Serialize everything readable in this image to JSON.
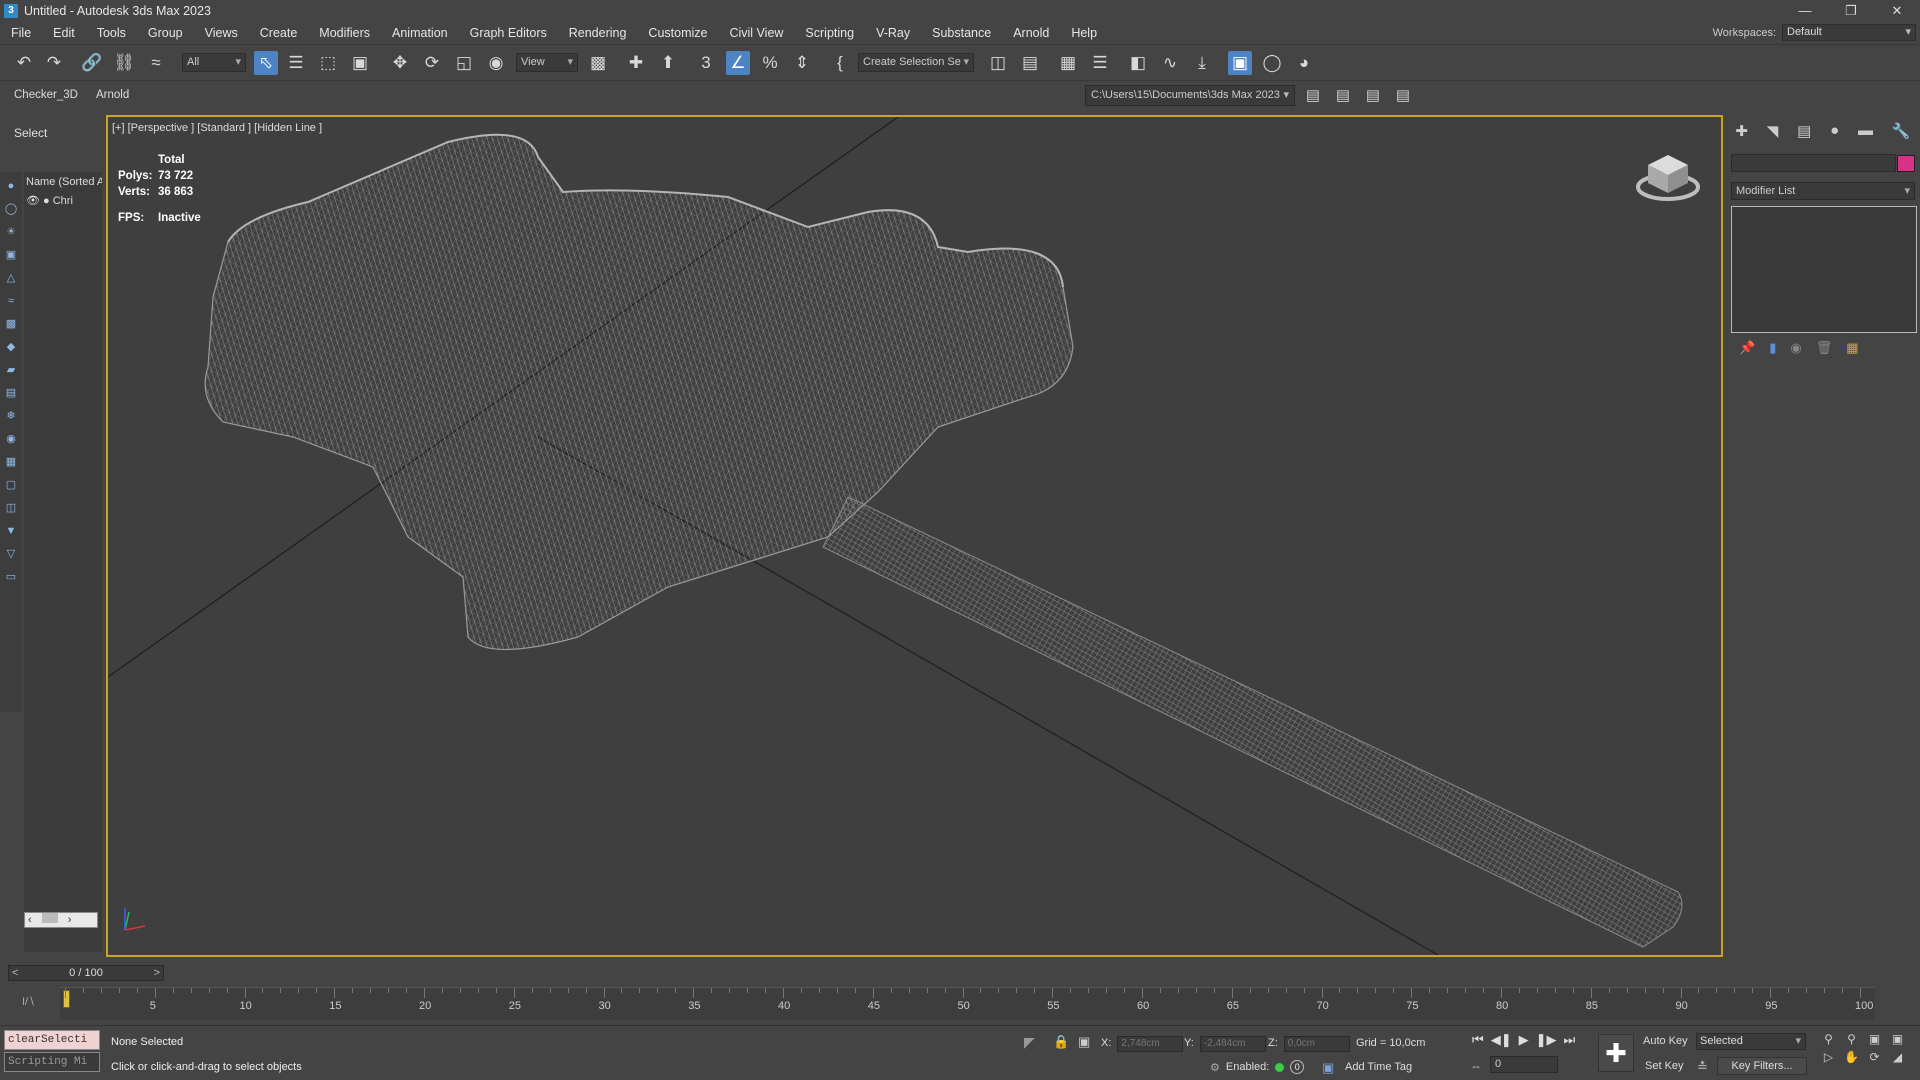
{
  "window": {
    "title": "Untitled - Autodesk 3ds Max 2023",
    "app_icon": "3"
  },
  "menu": [
    "File",
    "Edit",
    "Tools",
    "Group",
    "Views",
    "Create",
    "Modifiers",
    "Animation",
    "Graph Editors",
    "Rendering",
    "Customize",
    "Civil View",
    "Scripting",
    "V-Ray",
    "Substance",
    "Arnold",
    "Help"
  ],
  "workspace": {
    "label": "Workspaces:",
    "value": "Default"
  },
  "toolbar": {
    "filter_value": "All",
    "ref_coord_value": "View",
    "selection_set_value": "Create Selection Se",
    "snap_angle_label": "3"
  },
  "ribbon": {
    "tabs": [
      "Checker_3D",
      "Arnold"
    ],
    "project_path": "C:\\Users\\15\\Documents\\3ds Max 2023"
  },
  "scene_explorer": {
    "header": "Select",
    "column_header": "Name (Sorted A",
    "row_label": "Chri"
  },
  "viewport": {
    "label": "[+] [Perspective ] [Standard ] [Hidden Line ]",
    "stats": {
      "title": "Total",
      "polys_label": "Polys:",
      "polys": "73 722",
      "verts_label": "Verts:",
      "verts": "36 863",
      "fps_label": "FPS:",
      "fps": "Inactive"
    }
  },
  "command_panel": {
    "modifier_list": "Modifier List",
    "color": "#d8318a"
  },
  "timeline": {
    "slider_label": "0 / 100",
    "ticks": [
      "5",
      "10",
      "15",
      "20",
      "25",
      "30",
      "35",
      "40",
      "45",
      "50",
      "55",
      "60",
      "65",
      "70",
      "75",
      "80",
      "85",
      "90",
      "95",
      "100"
    ]
  },
  "status": {
    "maxscript_line1": "clearSelecti",
    "maxscript_line2": "Scripting Mi",
    "selection_status": "None Selected",
    "prompt": "Click or click-and-drag to select objects",
    "x_label": "X:",
    "x_value": "2,748cm",
    "y_label": "Y:",
    "y_value": "-2,484cm",
    "z_label": "Z:",
    "z_value": "0,0cm",
    "grid": "Grid = 10,0cm",
    "enabled_label": "Enabled:",
    "enabled_count": "0",
    "add_time_tag": "Add Time Tag",
    "frame_value": "0",
    "auto_key": "Auto Key",
    "set_key": "Set Key",
    "selected_value": "Selected",
    "key_filters": "Key Filters..."
  }
}
